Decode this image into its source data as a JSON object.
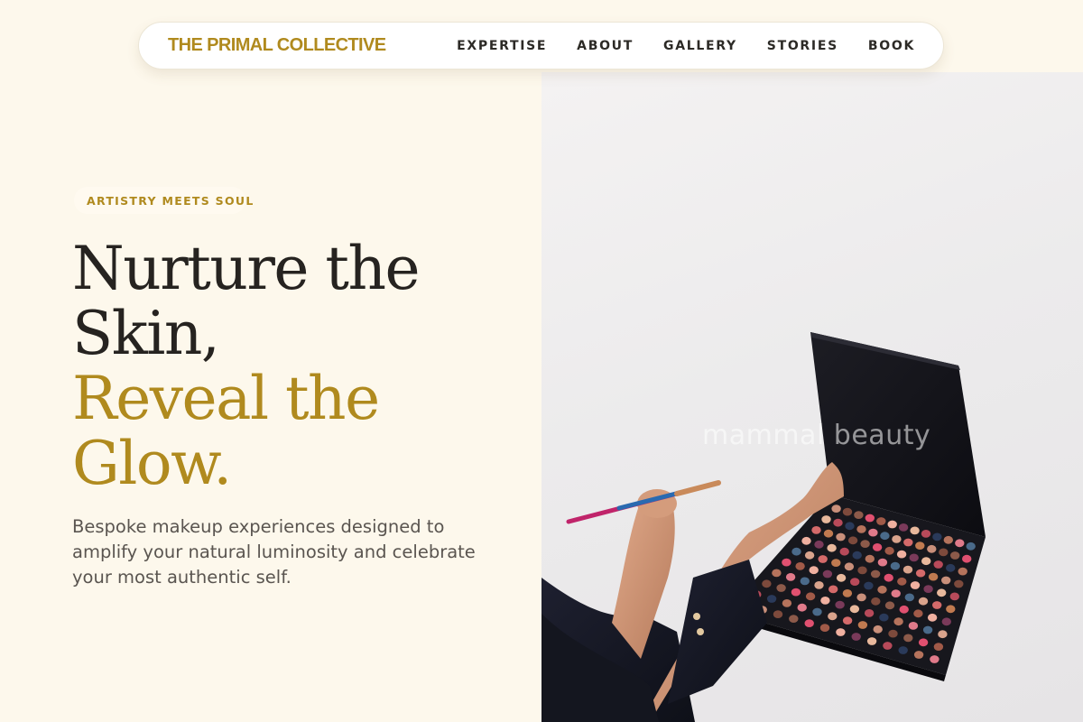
{
  "nav": {
    "brand": "THE PRIMAL COLLECTIVE",
    "links": [
      "EXPERTISE",
      "ABOUT",
      "GALLERY",
      "STORIES",
      "BOOK"
    ]
  },
  "hero": {
    "eyebrow": "ARTISTRY MEETS SOUL",
    "headline_lines": [
      "Nurture the",
      "Skin,",
      "Reveal the",
      "Glow."
    ],
    "subtext": "Bespoke makeup experiences designed to amplify your natural luminosity and celebrate your most authentic self.",
    "image_watermark": "mammal beauty"
  },
  "colors": {
    "background": "#fdf8ec",
    "accent_gold": "#b08a1e",
    "text_dark": "#262320",
    "text_muted": "#5a5550"
  }
}
